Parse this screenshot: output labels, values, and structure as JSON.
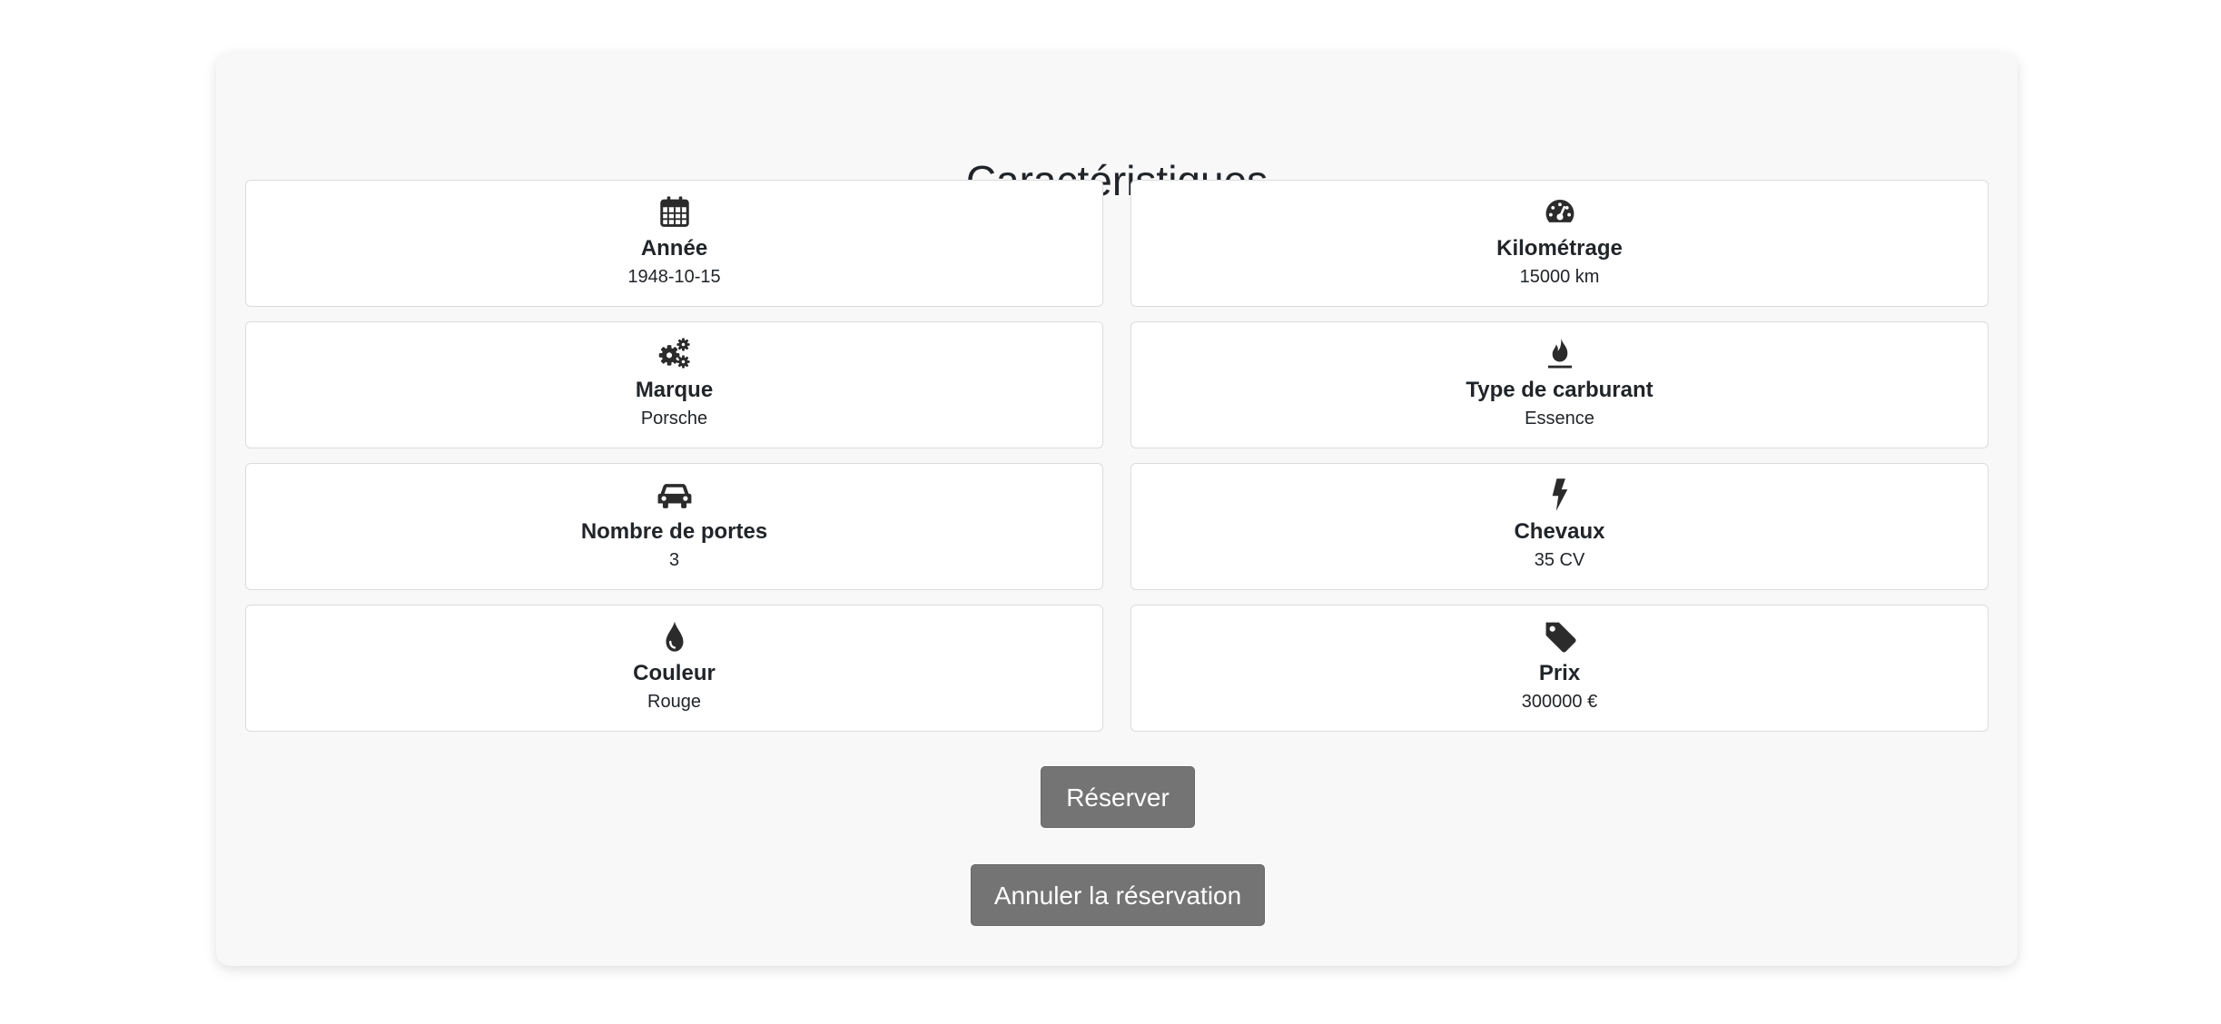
{
  "section": {
    "title": "Caractéristiques"
  },
  "features": [
    {
      "icon": "calendar-icon",
      "label": "Année",
      "value": "1948-10-15"
    },
    {
      "icon": "speedometer-icon",
      "label": "Kilométrage",
      "value": "15000 km"
    },
    {
      "icon": "gears-icon",
      "label": "Marque",
      "value": "Porsche"
    },
    {
      "icon": "fuel-flame-icon",
      "label": "Type de carburant",
      "value": "Essence"
    },
    {
      "icon": "car-icon",
      "label": "Nombre de portes",
      "value": "3"
    },
    {
      "icon": "lightning-bolt-icon",
      "label": "Chevaux",
      "value": "35 CV"
    },
    {
      "icon": "paint-drop-icon",
      "label": "Couleur",
      "value": "Rouge"
    },
    {
      "icon": "price-tag-icon",
      "label": "Prix",
      "value": "300000 €"
    }
  ],
  "actions": {
    "reserve_label": "Réserver",
    "cancel_label": "Annuler la réservation"
  },
  "colors": {
    "panel_bg": "#f8f8f8",
    "card_bg": "#ffffff",
    "button_bg": "#747474",
    "text": "#212529"
  }
}
